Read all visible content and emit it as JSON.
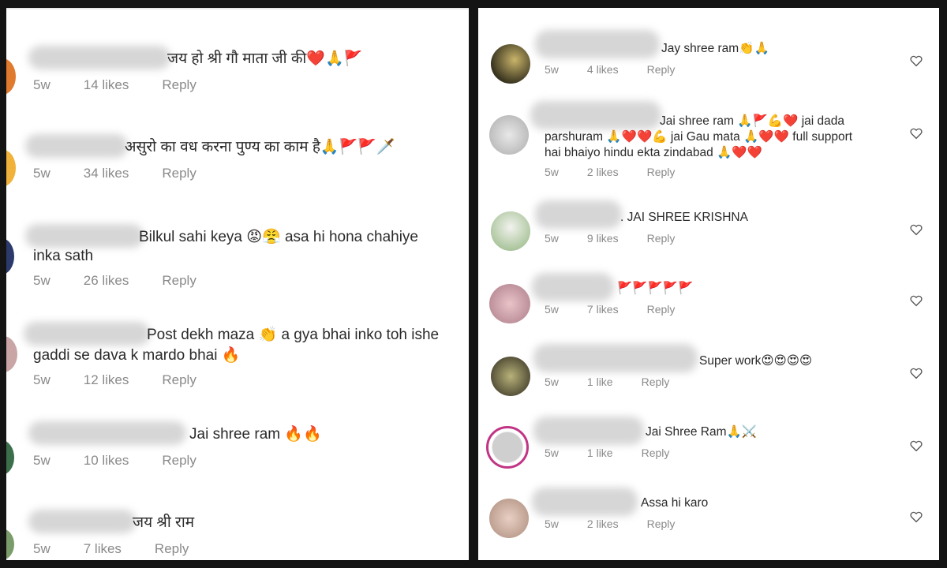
{
  "left_comments": [
    {
      "text": "जय हो श्री गौ माता जी की❤️🙏🚩",
      "age": "5w",
      "likes": "14 likes",
      "reply": "Reply"
    },
    {
      "text": "असुरो का वध करना पुण्य का काम है🙏🚩🚩🗡️",
      "age": "5w",
      "likes": "34 likes",
      "reply": "Reply"
    },
    {
      "text": "Bilkul sahi keya 😡😤 asa hi hona chahiye",
      "text2": "inka sath",
      "age": "5w",
      "likes": "26 likes",
      "reply": "Reply"
    },
    {
      "text": "Post dekh maza 👏 a gya bhai inko toh ishe",
      "text2": "gaddi se dava k mardo bhai 🔥",
      "age": "5w",
      "likes": "12 likes",
      "reply": "Reply"
    },
    {
      "text": "Jai shree ram 🔥🔥",
      "age": "5w",
      "likes": "10 likes",
      "reply": "Reply"
    },
    {
      "text": "जय श्री राम",
      "age": "5w",
      "likes": "7 likes",
      "reply": "Reply"
    }
  ],
  "right_comments": [
    {
      "text": "Jay shree ram👏🙏",
      "age": "5w",
      "likes": "4 likes",
      "reply": "Reply"
    },
    {
      "text": "Jai shree ram 🙏🚩💪❤️ jai dada",
      "text2": "parshuram 🙏❤️❤️💪 jai Gau mata 🙏❤️❤️ full support",
      "text3": "hai bhaiyo hindu ekta zindabad 🙏❤️❤️",
      "age": "5w",
      "likes": "2 likes",
      "reply": "Reply"
    },
    {
      "text": ". JAI SHREE KRISHNA",
      "age": "5w",
      "likes": "9 likes",
      "reply": "Reply"
    },
    {
      "text": "🚩🚩🚩🚩🚩",
      "age": "5w",
      "likes": "7 likes",
      "reply": "Reply"
    },
    {
      "text": "Super work😍😍😍😍",
      "age": "5w",
      "likes": "1 like",
      "reply": "Reply"
    },
    {
      "text": "Jai Shree Ram🙏⚔️",
      "age": "5w",
      "likes": "1 like",
      "reply": "Reply"
    },
    {
      "text": "Assa hi karo",
      "age": "5w",
      "likes": "2 likes",
      "reply": "Reply"
    }
  ],
  "icons": {
    "like": "heart-outline-icon"
  },
  "colors": {
    "text": "#2a2a2a",
    "meta": "#8a8a8a",
    "panel_bg": "#ffffff",
    "frame": "#141414"
  }
}
